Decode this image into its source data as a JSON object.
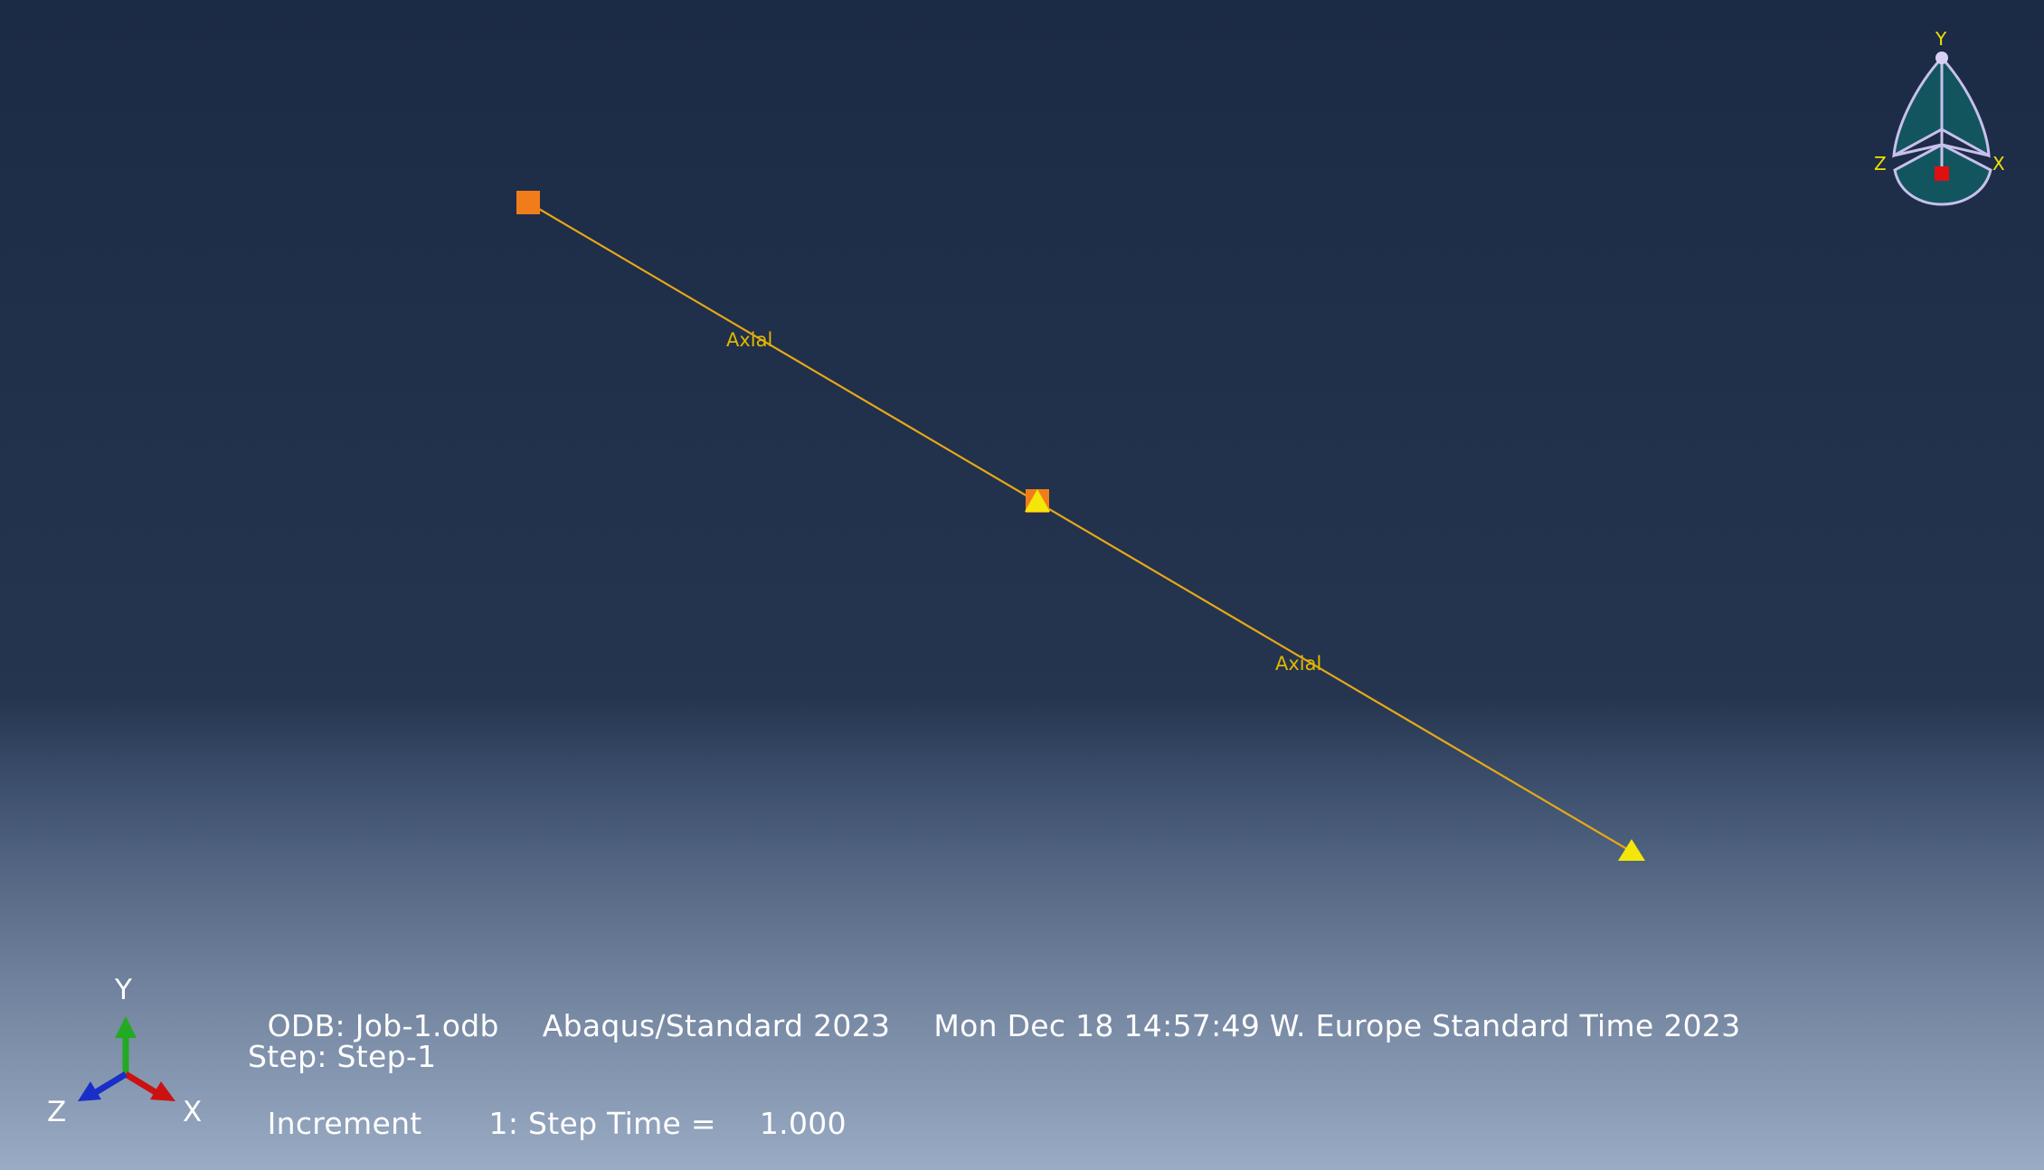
{
  "model": {
    "segment_label_1": "Axial",
    "segment_label_2": "Axial",
    "line_color": "#e6a817",
    "square_marker_color": "#f07d1a",
    "triangle_marker_color": "#f5e60a"
  },
  "view_cube": {
    "y_label": "Y",
    "z_label": "Z",
    "x_label": "X",
    "fill_color": "#12555f",
    "edge_color": "#c8c0ec",
    "center_color": "#e01010"
  },
  "triad": {
    "y_label": "Y",
    "z_label": "Z",
    "x_label": "X",
    "y_color": "#22aa22",
    "x_color": "#cc1111",
    "z_color": "#1a2ec8"
  },
  "info": {
    "odb": "ODB: Job-1.odb",
    "solver": "Abaqus/Standard 2023",
    "timestamp": "Mon Dec 18 14:57:49 W. Europe Standard Time 2023",
    "step": "Step: Step-1",
    "increment_label": "Increment",
    "increment_value": "1: Step Time =",
    "step_time": "1.000"
  }
}
